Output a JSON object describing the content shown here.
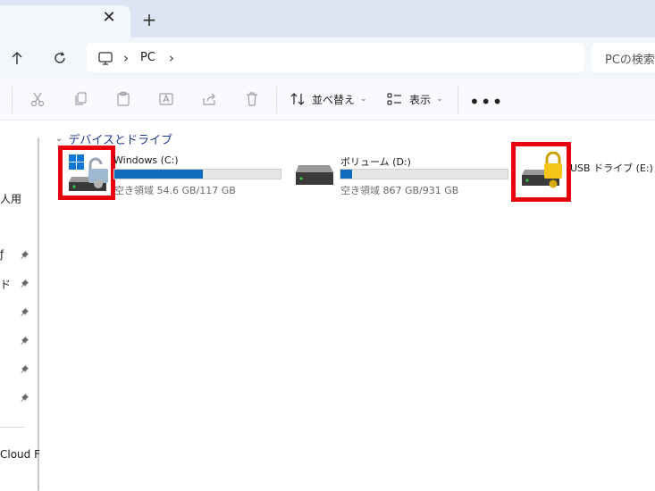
{
  "tabs": {
    "close_glyph": "✕",
    "new_glyph": "+"
  },
  "nav": {
    "up_glyph": "↑",
    "refresh_glyph": "↻"
  },
  "address": {
    "chevron": "›",
    "crumb": "PC",
    "chevron_end": "›"
  },
  "search": {
    "placeholder": "PCの検索"
  },
  "toolbar": {
    "sort_label": "並べ替え",
    "view_label": "表示",
    "more_label": "•••",
    "caret": "⌄"
  },
  "sidebar": {
    "items": [
      {
        "label": "人用",
        "pinned": false
      },
      {
        "label": "ƒ",
        "pinned": true
      },
      {
        "label": "ド",
        "pinned": true
      },
      {
        "label": "",
        "pinned": true
      },
      {
        "label": "",
        "pinned": true
      },
      {
        "label": "",
        "pinned": true
      },
      {
        "label": "",
        "pinned": true
      },
      {
        "label": "Cloud F",
        "pinned": false
      }
    ]
  },
  "section": {
    "title": "デバイスとドライブ",
    "chevron": "⌄"
  },
  "drives": [
    {
      "name": "Windows (C:)",
      "free_text": "空き領域 54.6 GB/117 GB",
      "used_fraction": 0.53,
      "lock": "unlocked",
      "highlighted": true
    },
    {
      "name": "ボリューム (D:)",
      "free_text": "空き領域 867 GB/931 GB",
      "used_fraction": 0.07,
      "lock": "none",
      "highlighted": false
    },
    {
      "name": "USB ドライブ (E:)",
      "free_text": "",
      "lock": "locked",
      "highlighted": true
    }
  ],
  "colors": {
    "highlight": "#e8000c",
    "usage_bar": "#0f6cbd",
    "section_title": "#1f3a93"
  }
}
